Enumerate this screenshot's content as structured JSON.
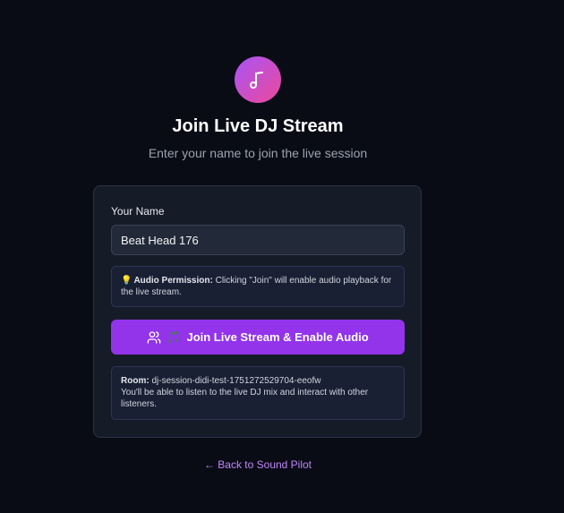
{
  "header": {
    "icon": "music-note-icon",
    "title": "Join Live DJ Stream",
    "subtitle": "Enter your name to join the live session"
  },
  "form": {
    "name_label": "Your Name",
    "name_value": "Beat Head 176",
    "notice": {
      "icon": "lightbulb-icon",
      "bold": "Audio Permission:",
      "text": "Clicking \"Join\" will enable audio playback for the live stream."
    },
    "join_button": {
      "icon_users": "users-icon",
      "icon_music": "music-notes-icon",
      "label": "Join Live Stream & Enable Audio"
    },
    "room_info": {
      "bold": "Room:",
      "room_id": "dj-session-didi-test-1751272529704-eeofw",
      "description": "You'll be able to listen to the live DJ mix and interact with other listeners."
    }
  },
  "footer": {
    "back_link": "← Back to Sound Pilot"
  },
  "colors": {
    "background": "#090b15",
    "card": "#161b28",
    "accent": "#9333ea",
    "link": "#c084fc"
  }
}
